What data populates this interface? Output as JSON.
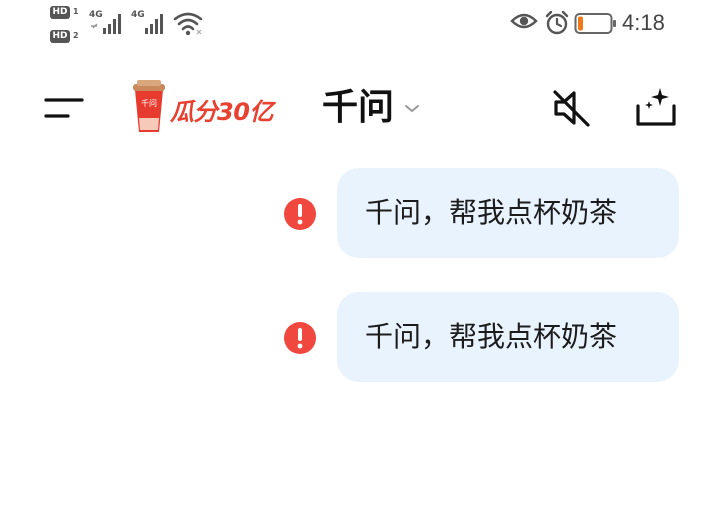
{
  "status_bar": {
    "sim1_badge": "HD",
    "sim1_number": "1",
    "sim2_badge": "HD",
    "sim2_number": "2",
    "network1": "4G",
    "network2": "4G",
    "time": "4:18",
    "battery_level": 0.15,
    "battery_color": "#f07a1a"
  },
  "header": {
    "promo_cup_label": "千问",
    "promo_text": "瓜分30亿",
    "title": "千问",
    "icons": [
      "menu-icon",
      "mute-icon",
      "new-chat-icon"
    ]
  },
  "chat": {
    "messages": [
      {
        "text": "千问，帮我点杯奶茶",
        "status": "failed"
      },
      {
        "text": "千问，帮我点杯奶茶",
        "status": "failed"
      }
    ]
  },
  "colors": {
    "bubble": "#e9f3fe",
    "error": "#f0473e",
    "promo": "#e8412f"
  }
}
